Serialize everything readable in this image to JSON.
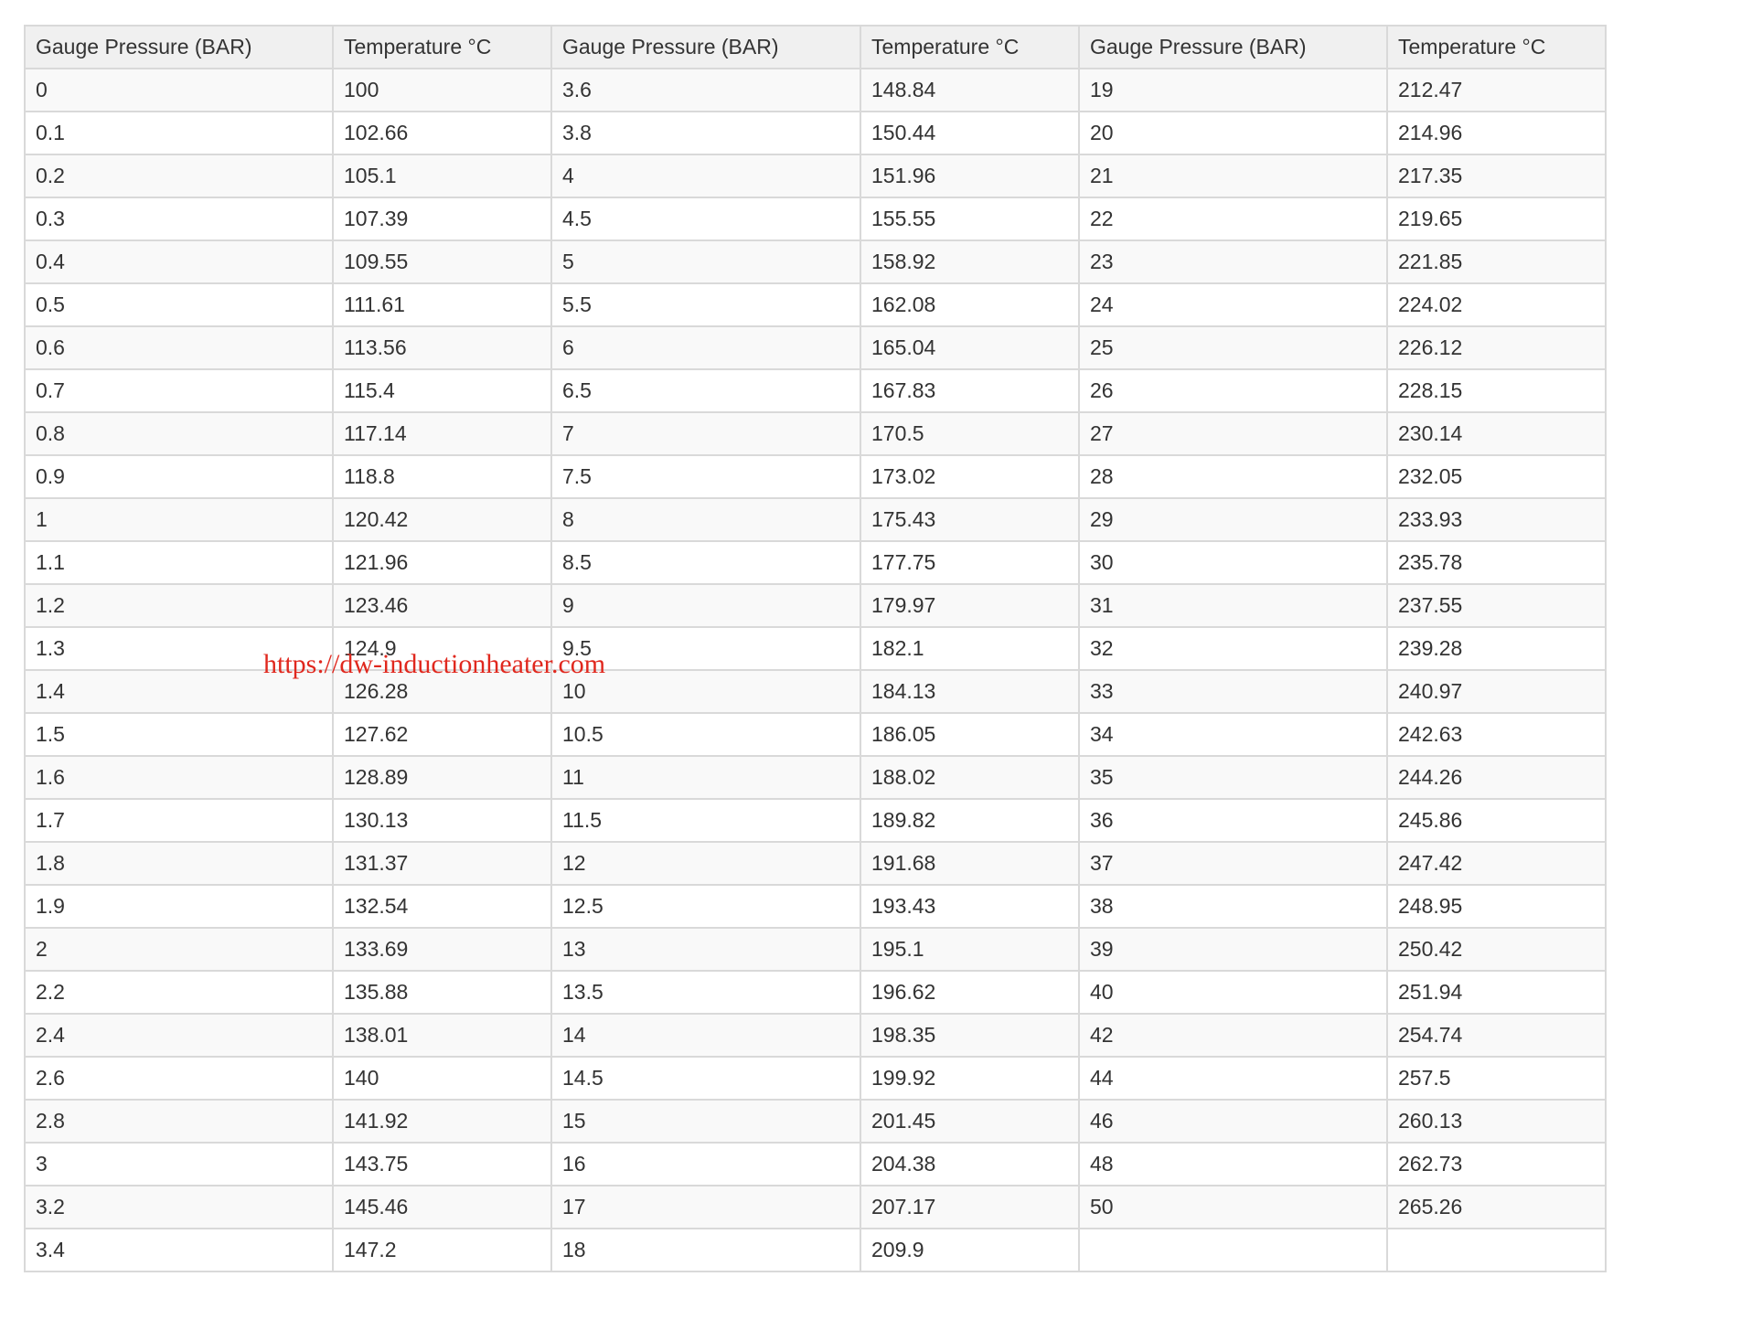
{
  "table": {
    "headers": [
      "Gauge Pressure (BAR)",
      "Temperature °C",
      "Gauge Pressure (BAR)",
      "Temperature °C",
      "Gauge Pressure (BAR)",
      "Temperature °C"
    ],
    "rows": [
      [
        "0",
        "100",
        "3.6",
        "148.84",
        "19",
        "212.47"
      ],
      [
        "0.1",
        "102.66",
        "3.8",
        "150.44",
        "20",
        "214.96"
      ],
      [
        "0.2",
        "105.1",
        "4",
        "151.96",
        "21",
        "217.35"
      ],
      [
        "0.3",
        "107.39",
        "4.5",
        "155.55",
        "22",
        "219.65"
      ],
      [
        "0.4",
        "109.55",
        "5",
        "158.92",
        "23",
        "221.85"
      ],
      [
        "0.5",
        "111.61",
        "5.5",
        "162.08",
        "24",
        "224.02"
      ],
      [
        "0.6",
        "113.56",
        "6",
        "165.04",
        "25",
        "226.12"
      ],
      [
        "0.7",
        "115.4",
        "6.5",
        "167.83",
        "26",
        "228.15"
      ],
      [
        "0.8",
        "117.14",
        "7",
        "170.5",
        "27",
        "230.14"
      ],
      [
        "0.9",
        "118.8",
        "7.5",
        "173.02",
        "28",
        "232.05"
      ],
      [
        "1",
        "120.42",
        "8",
        "175.43",
        "29",
        "233.93"
      ],
      [
        "1.1",
        "121.96",
        "8.5",
        "177.75",
        "30",
        "235.78"
      ],
      [
        "1.2",
        "123.46",
        "9",
        "179.97",
        "31",
        "237.55"
      ],
      [
        "1.3",
        "124.9",
        "9.5",
        "182.1",
        "32",
        "239.28"
      ],
      [
        "1.4",
        "126.28",
        "10",
        "184.13",
        "33",
        "240.97"
      ],
      [
        "1.5",
        "127.62",
        "10.5",
        "186.05",
        "34",
        "242.63"
      ],
      [
        "1.6",
        "128.89",
        "11",
        "188.02",
        "35",
        "244.26"
      ],
      [
        "1.7",
        "130.13",
        "11.5",
        "189.82",
        "36",
        "245.86"
      ],
      [
        "1.8",
        "131.37",
        "12",
        "191.68",
        "37",
        "247.42"
      ],
      [
        "1.9",
        "132.54",
        "12.5",
        "193.43",
        "38",
        "248.95"
      ],
      [
        "2",
        "133.69",
        "13",
        "195.1",
        "39",
        "250.42"
      ],
      [
        "2.2",
        "135.88",
        "13.5",
        "196.62",
        "40",
        "251.94"
      ],
      [
        "2.4",
        "138.01",
        "14",
        "198.35",
        "42",
        "254.74"
      ],
      [
        "2.6",
        "140",
        "14.5",
        "199.92",
        "44",
        "257.5"
      ],
      [
        "2.8",
        "141.92",
        "15",
        "201.45",
        "46",
        "260.13"
      ],
      [
        "3",
        "143.75",
        "16",
        "204.38",
        "48",
        "262.73"
      ],
      [
        "3.2",
        "145.46",
        "17",
        "207.17",
        "50",
        "265.26"
      ],
      [
        "3.4",
        "147.2",
        "18",
        "209.9",
        "",
        ""
      ]
    ]
  },
  "watermark": {
    "text": "https://dw-inductionheater.com"
  },
  "colors": {
    "border": "#d9d9d9",
    "header_bg": "#f0f0f0",
    "stripe_bg": "#f9f9f9",
    "text": "#333333",
    "watermark": "#e0281e"
  }
}
